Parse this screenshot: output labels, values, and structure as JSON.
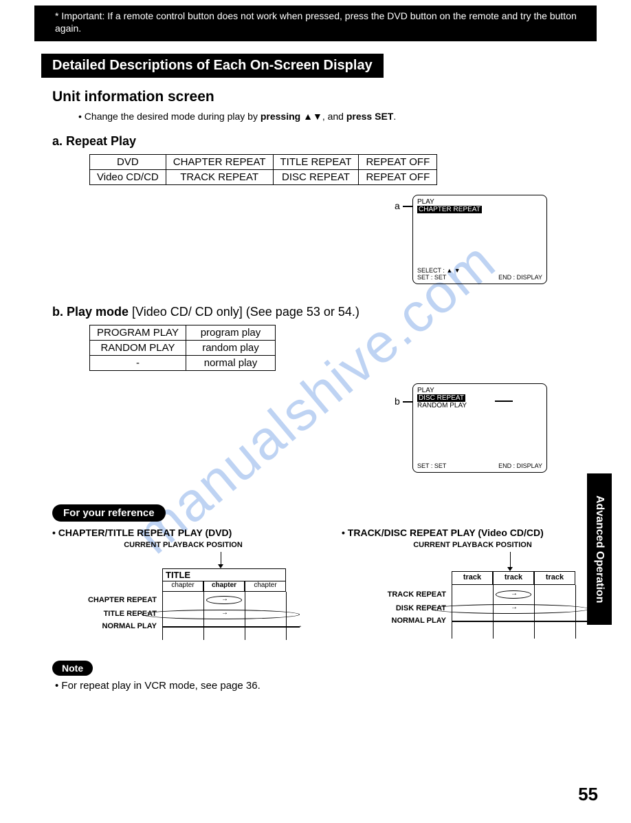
{
  "watermark": "manualshive.com",
  "important": {
    "label": "* Important:",
    "text": "If a remote control button does not work when pressed, press the DVD button on the remote and try the button again."
  },
  "section_title": "Detailed Descriptions of Each On-Screen Display",
  "unit_info": {
    "title": "Unit information screen",
    "bullet_pre": "Change the desired mode during play by ",
    "bullet_bold1": "pressing ",
    "bullet_arrows": "▲▼",
    "bullet_mid": ", and ",
    "bullet_bold2": "press SET",
    "bullet_end": "."
  },
  "a": {
    "title": "a. Repeat Play",
    "table": {
      "r1": [
        "DVD",
        "CHAPTER REPEAT",
        "TITLE REPEAT",
        "REPEAT OFF"
      ],
      "r2": [
        "Video CD/CD",
        "TRACK REPEAT",
        "DISC REPEAT",
        "REPEAT OFF"
      ]
    },
    "label": "a",
    "osd": {
      "play": "PLAY",
      "hi": "CHAPTER REPEAT",
      "select": "SELECT : ▲ ▼",
      "set": "SET      : SET",
      "end": "END  : DISPLAY"
    }
  },
  "b": {
    "title_bold": "b. Play mode ",
    "title_light": "[Video CD/ CD only] (See page 53 or 54.)",
    "table": {
      "r1": [
        "PROGRAM PLAY",
        "program play"
      ],
      "r2": [
        "RANDOM PLAY",
        "random play"
      ],
      "r3": [
        "-",
        "normal play"
      ]
    },
    "label": "b",
    "osd": {
      "play": "PLAY",
      "hi": "DISC  REPEAT",
      "line2": "RANDOM PLAY",
      "set": "SET      : SET",
      "end": "END  : DISPLAY"
    }
  },
  "ref": {
    "pill": "For your reference",
    "left": {
      "h": "• CHAPTER/TITLE REPEAT PLAY (DVD)",
      "sub": "CURRENT PLAYBACK POSITION",
      "title_box": "TITLE",
      "cells": [
        "chapter",
        "chapter",
        "chapter"
      ],
      "rows": [
        "CHAPTER REPEAT",
        "TITLE REPEAT",
        "NORMAL PLAY"
      ]
    },
    "right": {
      "h": "• TRACK/DISC REPEAT PLAY (Video CD/CD)",
      "sub": "CURRENT PLAYBACK POSITION",
      "cells": [
        "track",
        "track",
        "track"
      ],
      "rows": [
        "TRACK REPEAT",
        "DISK REPEAT",
        "NORMAL PLAY"
      ]
    }
  },
  "note": {
    "pill": "Note",
    "text": "For repeat play in VCR mode, see page 36."
  },
  "side_tab": "Advanced Operation",
  "page_num": "55"
}
